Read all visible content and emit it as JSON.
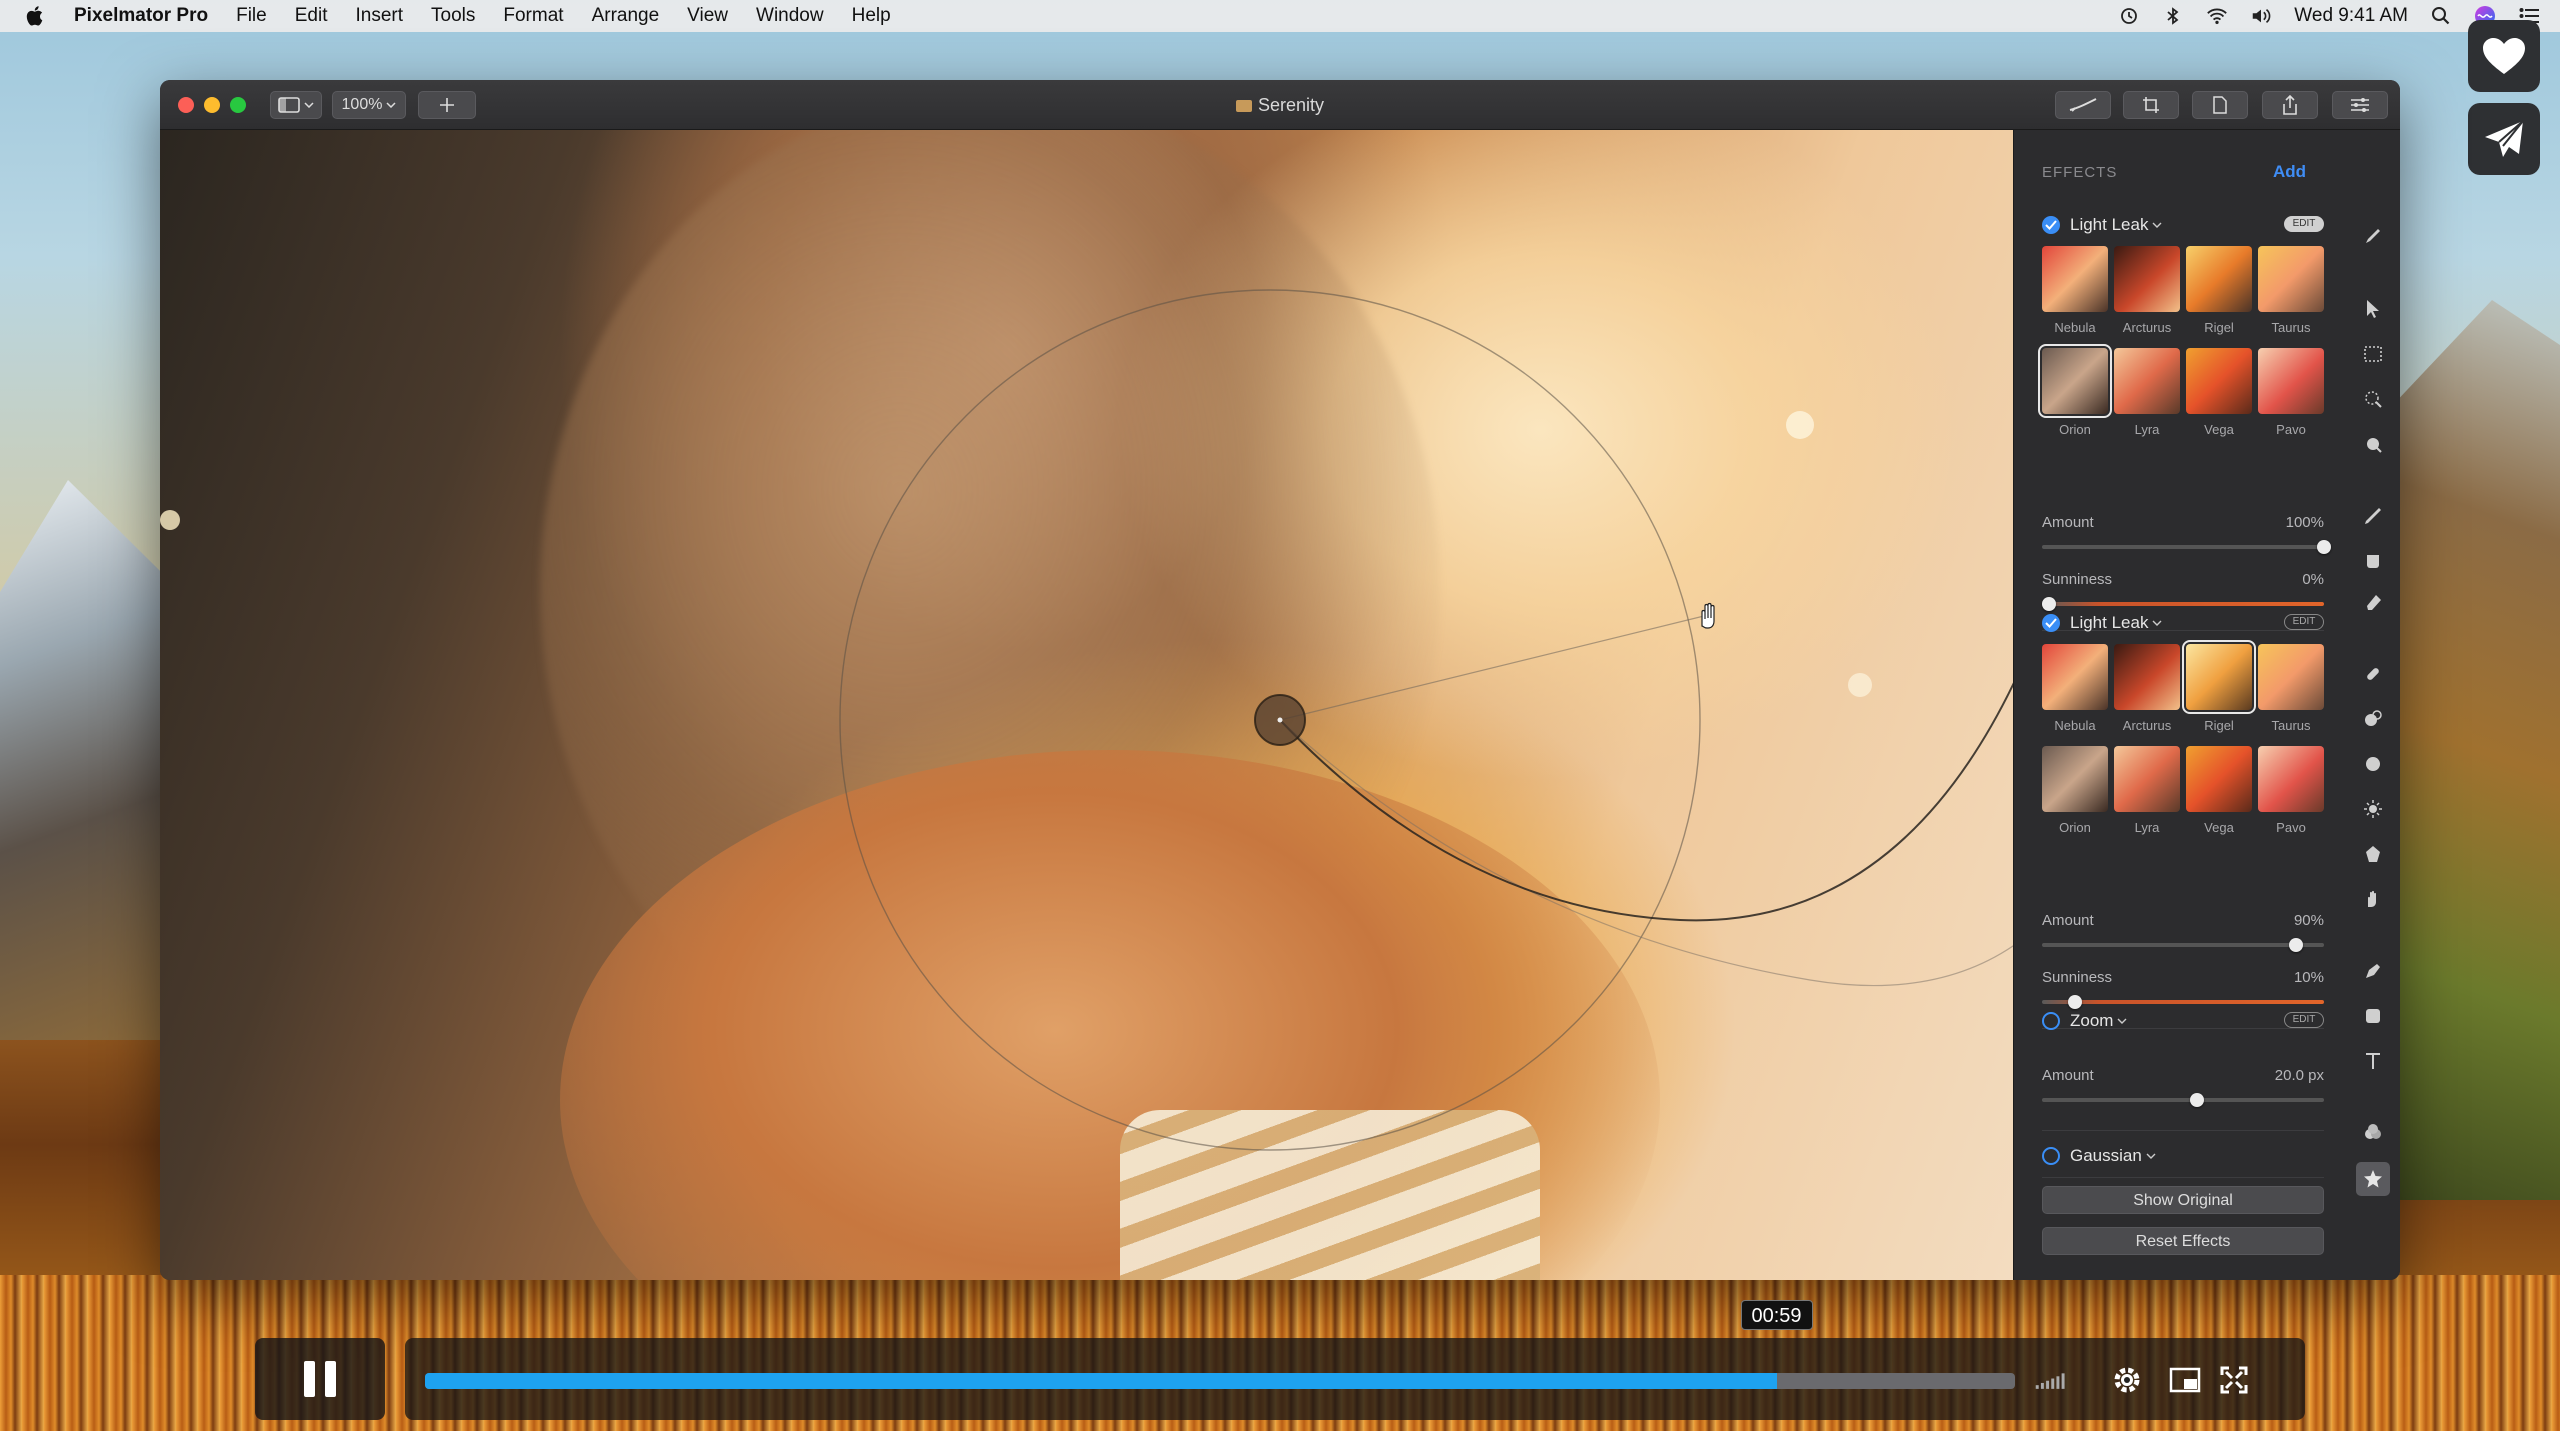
{
  "menubar": {
    "app_name": "Pixelmator Pro",
    "items": [
      "File",
      "Edit",
      "Insert",
      "Tools",
      "Format",
      "Arrange",
      "View",
      "Window",
      "Help"
    ],
    "clock": "Wed 9:41 AM"
  },
  "window": {
    "title": "Serenity",
    "zoom": "100%"
  },
  "effects": {
    "header": "EFFECTS",
    "add_label": "Add",
    "edit_label": "EDIT",
    "blocks": [
      {
        "name": "Light Leak",
        "enabled": true,
        "presets": [
          "Nebula",
          "Arcturus",
          "Rigel",
          "Taurus",
          "Orion",
          "Lyra",
          "Vega",
          "Pavo"
        ],
        "selected_preset": "Orion",
        "amount_label": "Amount",
        "amount_value": "100%",
        "sunniness_label": "Sunniness",
        "sunniness_value": "0%"
      },
      {
        "name": "Light Leak",
        "enabled": true,
        "presets": [
          "Nebula",
          "Arcturus",
          "Rigel",
          "Taurus",
          "Orion",
          "Lyra",
          "Vega",
          "Pavo"
        ],
        "selected_preset": "Rigel",
        "amount_label": "Amount",
        "amount_value": "90%",
        "sunniness_label": "Sunniness",
        "sunniness_value": "10%"
      },
      {
        "name": "Zoom",
        "enabled": false,
        "amount_label": "Amount",
        "amount_value": "20.0 px"
      },
      {
        "name": "Gaussian",
        "enabled": false
      }
    ],
    "show_original": "Show Original",
    "reset_effects": "Reset Effects"
  },
  "player": {
    "time": "00:59",
    "progress": 0.85
  },
  "colors": {
    "accent": "#3a8ef6",
    "progress": "#1ea2f0"
  }
}
